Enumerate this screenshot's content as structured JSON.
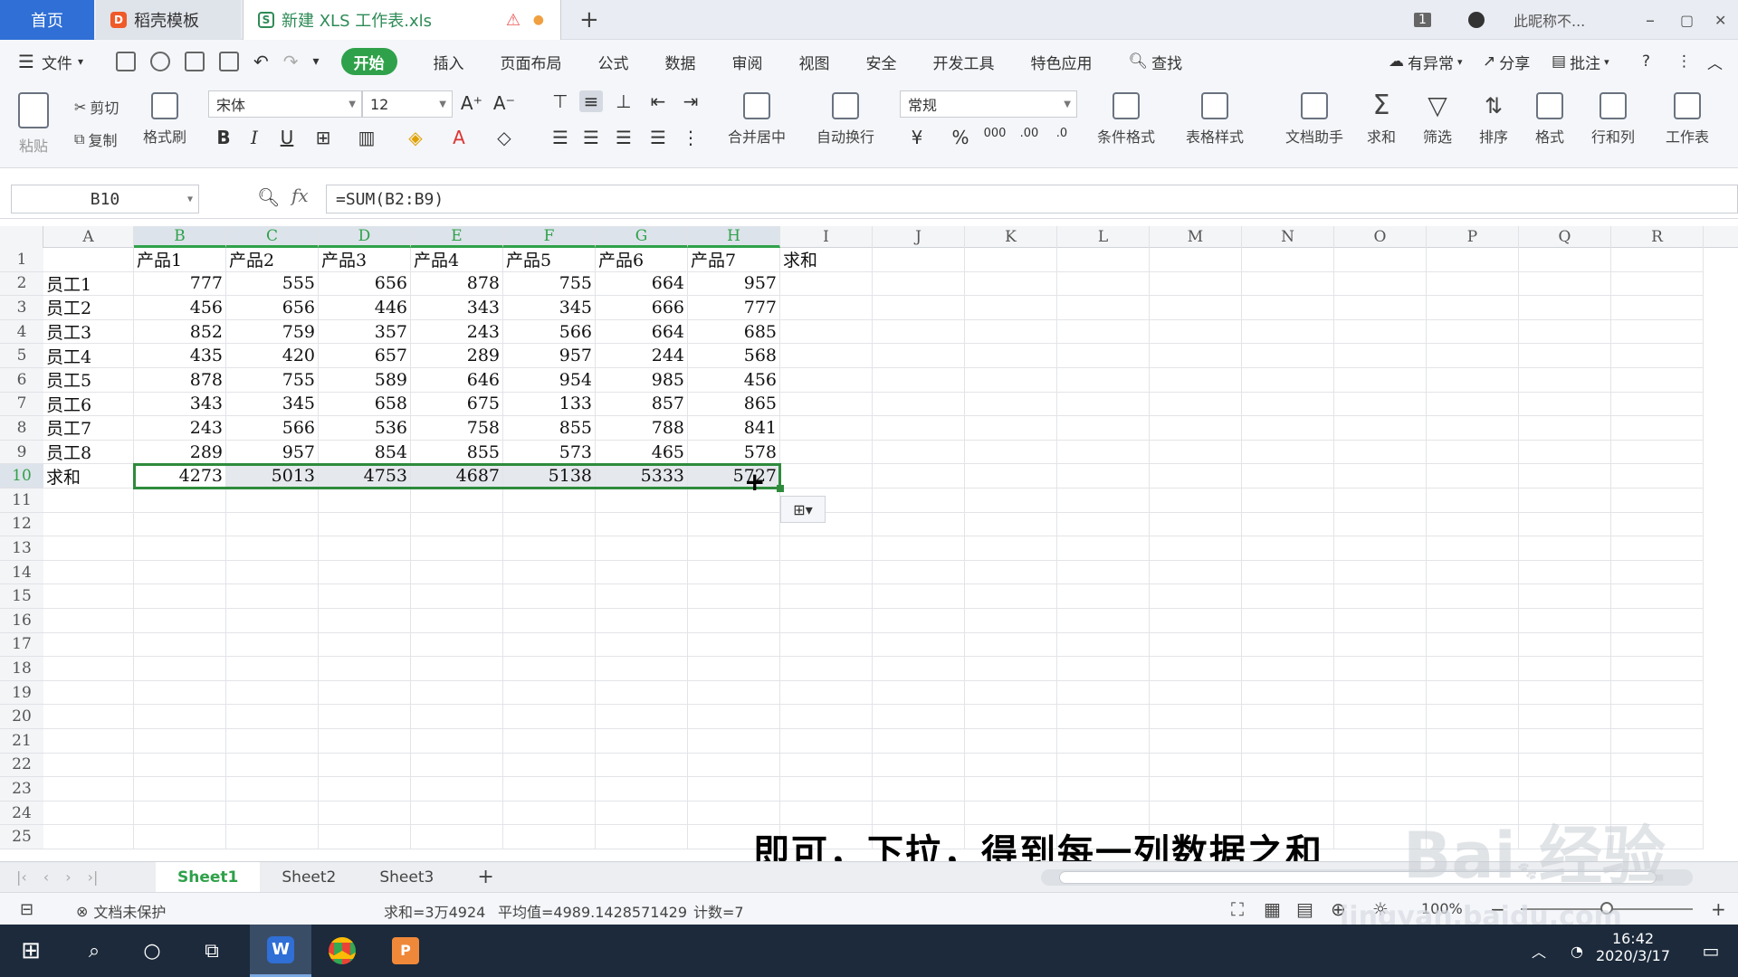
{
  "tabs": {
    "home": "首页",
    "template": "稻壳模板",
    "document": "新建 XLS 工作表.xls",
    "add": "+"
  },
  "window": {
    "badge": "1",
    "user": "此昵称不...",
    "minimize": "–",
    "restore": "▢",
    "close": "✕"
  },
  "menu": {
    "file": "文件",
    "items": [
      "开始",
      "插入",
      "页面布局",
      "公式",
      "数据",
      "审阅",
      "视图",
      "安全",
      "开发工具",
      "特色应用"
    ],
    "search": "查找",
    "right": [
      "有异常",
      "分享",
      "批注"
    ],
    "help": "?"
  },
  "ribbon": {
    "paste": "粘贴",
    "cut": "剪切",
    "copy": "复制",
    "format_painter": "格式刷",
    "font": "宋体",
    "font_size": "12",
    "bold": "B",
    "italic": "I",
    "underline": "U",
    "merge": "合并居中",
    "wrap": "自动换行",
    "number_format": "常规",
    "percent": "%",
    "cond_format": "条件格式",
    "table_style": "表格样式",
    "doc_assistant": "文档助手",
    "sum": "求和",
    "filter": "筛选",
    "sort": "排序",
    "format": "格式",
    "rows_cols": "行和列",
    "worksheet": "工作表"
  },
  "formula_bar": {
    "cell_ref": "B10",
    "fx": "fx",
    "formula": "=SUM(B2:B9)"
  },
  "columns": [
    "A",
    "B",
    "C",
    "D",
    "E",
    "F",
    "G",
    "H",
    "I",
    "J",
    "K",
    "L",
    "M",
    "N",
    "O",
    "P",
    "Q",
    "R"
  ],
  "rows": [
    "1",
    "2",
    "3",
    "4",
    "5",
    "6",
    "7",
    "8",
    "9",
    "10",
    "11",
    "12",
    "13",
    "14",
    "15",
    "16",
    "17",
    "18",
    "19",
    "20",
    "21",
    "22",
    "23",
    "24",
    "25"
  ],
  "grid": [
    [
      "",
      "产品1",
      "产品2",
      "产品3",
      "产品4",
      "产品5",
      "产品6",
      "产品7",
      "求和"
    ],
    [
      "员工1",
      "777",
      "555",
      "656",
      "878",
      "755",
      "664",
      "957",
      ""
    ],
    [
      "员工2",
      "456",
      "656",
      "446",
      "343",
      "345",
      "666",
      "777",
      ""
    ],
    [
      "员工3",
      "852",
      "759",
      "357",
      "243",
      "566",
      "664",
      "685",
      ""
    ],
    [
      "员工4",
      "435",
      "420",
      "657",
      "289",
      "957",
      "244",
      "568",
      ""
    ],
    [
      "员工5",
      "878",
      "755",
      "589",
      "646",
      "954",
      "985",
      "456",
      ""
    ],
    [
      "员工6",
      "343",
      "345",
      "658",
      "675",
      "133",
      "857",
      "865",
      ""
    ],
    [
      "员工7",
      "243",
      "566",
      "536",
      "758",
      "855",
      "788",
      "841",
      ""
    ],
    [
      "员工8",
      "289",
      "957",
      "854",
      "855",
      "573",
      "465",
      "578",
      ""
    ],
    [
      "求和",
      "4273",
      "5013",
      "4753",
      "4687",
      "5138",
      "5333",
      "5727",
      ""
    ]
  ],
  "sheets": [
    "Sheet1",
    "Sheet2",
    "Sheet3"
  ],
  "sheet_add": "+",
  "status": {
    "protect": "文档未保护",
    "sum": "求和=3万4924",
    "avg": "平均值=4989.1428571429",
    "count": "计数=7",
    "zoom": "100%"
  },
  "subtitle": "即可，下拉，得到每一列数据之和",
  "watermark": {
    "brand": "Bai",
    "brand_cn": "经验",
    "url": "jingyan.baidu.com"
  },
  "clock": {
    "time": "16:42",
    "date": "2020/3/17"
  },
  "colors": {
    "accent": "#2fa14a",
    "home_tab": "#2f6fd6",
    "taskbar": "#1c2a3b"
  }
}
